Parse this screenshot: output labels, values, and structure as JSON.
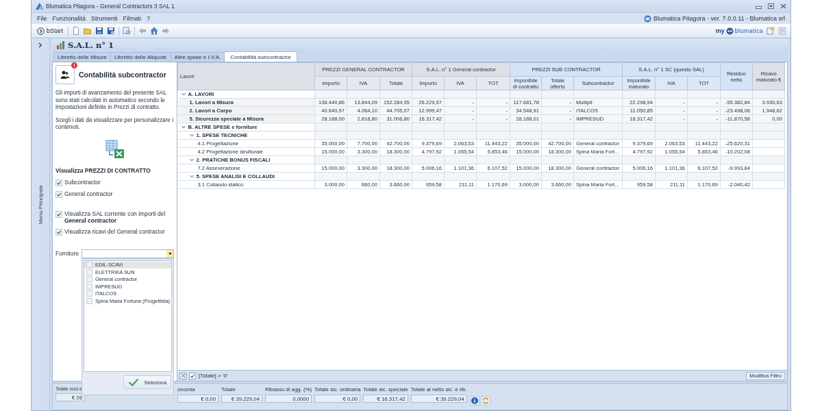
{
  "window": {
    "title": "Blumatica Pitagora - General Contractors 3 SAL 1"
  },
  "menu": [
    "File",
    "Funzionalità",
    "Strumenti",
    "Filmati",
    "?"
  ],
  "app_info": "Blumatica Pitagora - ver. 7.0.0.11 - Blumatica srl",
  "toolbar": {
    "start_label": "bStart",
    "brand_prefix": "my",
    "brand_name": "blumatica"
  },
  "side_menu": {
    "label": "Menu Principale"
  },
  "document": {
    "title": "S.A.L. n° 1"
  },
  "tabs": [
    {
      "label": "Libretto delle Misure",
      "selected": false
    },
    {
      "label": "Libretto delle Aliquote",
      "selected": false
    },
    {
      "label": "Altre spese e I.V.A.",
      "selected": false
    },
    {
      "label": "Contabilità subcontractor",
      "selected": true
    }
  ],
  "sidebar": {
    "title": "Contabilità subcontractor",
    "paragraphs": [
      "Gli importi di avanzamento del presente SAL sono stati calcolati in automatico secondo le impostazioni definite in Prezzi di contratto.",
      "Scegli i dati da visualizzare per personalizzare i contenuti."
    ],
    "section_title": "Visualizza PREZZI DI CONTRATTO",
    "options": [
      {
        "label": "Subcontractor",
        "checked": true
      },
      {
        "label": "General contractor",
        "checked": true
      },
      {
        "label": "Visualizza SAL corrente con importi del **General contractor**",
        "checked": true
      },
      {
        "label": "Visualizza ricavi del General contractor",
        "checked": true
      }
    ],
    "supplier": {
      "label": "Fornitore",
      "items": [
        {
          "label": "EDIL-SCAVI",
          "checked": false,
          "selected": true
        },
        {
          "label": "ELETTRIKA SUN",
          "checked": false,
          "selected": false
        },
        {
          "label": "General contractor",
          "checked": false,
          "selected": false
        },
        {
          "label": "IMPRESUD",
          "checked": false,
          "selected": false
        },
        {
          "label": "ITALCOS",
          "checked": false,
          "selected": false
        },
        {
          "label": "Spina Maria Fortuna (Progettista)",
          "checked": false,
          "selected": false
        }
      ],
      "confirm": "Seleziona"
    }
  },
  "table": {
    "column_groups": [
      {
        "label": "Lavori",
        "color": "#dde1e7"
      },
      {
        "label": "PREZZI GENERAL CONTRACTOR",
        "color": "#dde1e7",
        "columns": [
          "Importo",
          "IVA",
          "Totale"
        ]
      },
      {
        "label": "S.A.L. n° 1 General contractor",
        "color": "#dde1e7",
        "columns": [
          "Importo",
          "IVA",
          "TOT"
        ]
      },
      {
        "label": "PREZZI SUB CONTRACTOR",
        "color": "#d4e3f5",
        "columns": [
          "Imponibile di contratto",
          "Totale offerto",
          "Subcontractor"
        ]
      },
      {
        "label": "S.A.L. n° 1 SC (questo SAL)",
        "color": "#d4e3f5",
        "columns": [
          "Imponibile maturato",
          "IVA",
          "TOT"
        ]
      },
      {
        "label": "Residuo netto",
        "color": "#d4e3f5"
      },
      {
        "label": "Ricavo maturato €",
        "color": "#dde1e7"
      }
    ],
    "rows": [
      {
        "label": "A. LAVORI",
        "kind": "group",
        "expanded": true,
        "children": [
          {
            "label": "1. Lavori a Misura",
            "kind": "total",
            "values": [
              "138.440,86",
              "13.844,09",
              "152.284,95",
              "26.229,57",
              "-",
              "-",
              "117.681,78",
              "-",
              "Multipli",
              "22.298,94",
              "-",
              "-",
              "-95.382,84",
              "3.930,63"
            ]
          },
          {
            "label": "2. Lavori a Corpo",
            "kind": "total",
            "values": [
              "40.640,97",
              "4.064,10",
              "44.705,07",
              "12.999,47",
              "-",
              "-",
              "34.548,91",
              "-",
              "ITALCOS",
              "11.050,85",
              "-",
              "-",
              "-23.498,06",
              "1.948,62"
            ]
          },
          {
            "label": "5. Sicurezza speciale a Misura",
            "kind": "total",
            "values": [
              "28.188,00",
              "2.818,80",
              "31.006,80",
              "16.317,42",
              "-",
              "-",
              "28.188,01",
              "-",
              "IMPRESUD",
              "16.317,42",
              "-",
              "-",
              "-11.870,58",
              "0,00"
            ]
          }
        ]
      },
      {
        "label": "B. ALTRE SPESE e forniture",
        "kind": "group",
        "expanded": true,
        "children": [
          {
            "label": "1. SPESE TECNICHE",
            "kind": "group",
            "expanded": true,
            "children": [
              {
                "label": "4.1 Progettazione",
                "kind": "item",
                "values": [
                  "35.000,00",
                  "7.700,00",
                  "42.700,00",
                  "9.379,69",
                  "2.063,53",
                  "11.443,22",
                  "35.000,00",
                  "42.700,00",
                  "General contractor",
                  "9.379,69",
                  "2.063,53",
                  "11.443,22",
                  "-25.620,31"
                ]
              },
              {
                "label": "4.2 Progettazione strutturale",
                "kind": "item",
                "values": [
                  "15.000,00",
                  "3.300,00",
                  "18.300,00",
                  "4.797,92",
                  "1.055,54",
                  "5.853,46",
                  "15.000,00",
                  "18.300,00",
                  "Spina Maria Fort...",
                  "4.797,92",
                  "1.055,54",
                  "5.853,46",
                  "-10.202,08"
                ]
              }
            ]
          },
          {
            "label": "2. PRATICHE BONUS FISCALI",
            "kind": "group",
            "expanded": true,
            "children": [
              {
                "label": "7.2 Asseverazione",
                "kind": "item",
                "values": [
                  "15.000,00",
                  "3.300,00",
                  "18.300,00",
                  "5.006,16",
                  "1.101,36",
                  "6.107,52",
                  "15.000,00",
                  "18.300,00",
                  "General contractor",
                  "5.006,16",
                  "1.101,36",
                  "6.107,52",
                  "-9.993,84"
                ]
              }
            ]
          },
          {
            "label": "5. SPESE ANALISI E COLLAUDI",
            "kind": "group",
            "expanded": true,
            "children": [
              {
                "label": "3.1 Collaudo statico",
                "kind": "item",
                "values": [
                  "3.000,00",
                  "660,00",
                  "3.660,00",
                  "959,58",
                  "211,11",
                  "1.170,69",
                  "3.000,00",
                  "3.660,00",
                  "Spina Maria Fort...",
                  "959,58",
                  "211,11",
                  "1.170,69",
                  "-2.040,42"
                ]
              }
            ]
          }
        ]
      }
    ]
  },
  "filter": {
    "enabled": true,
    "expression": "[Totale] > '0'",
    "edit_button": "Modifica Filtro"
  },
  "totals": [
    {
      "label": "Totale voci a",
      "value": "€ 26"
    },
    {
      "label": "onomia",
      "value": "€ 0,00"
    },
    {
      "label": "Totale",
      "value": "€ 39.229,04"
    },
    {
      "label": "Ribasso di agg. (%)",
      "value": "0,0000"
    },
    {
      "label": "Totale sic. ordinaria",
      "value": "€ 0,00"
    },
    {
      "label": "Totale sic. speciale",
      "value": "€ 16.317,42"
    },
    {
      "label": "Totale al netto sic. e rib.",
      "value": "€ 39.229,04"
    }
  ]
}
